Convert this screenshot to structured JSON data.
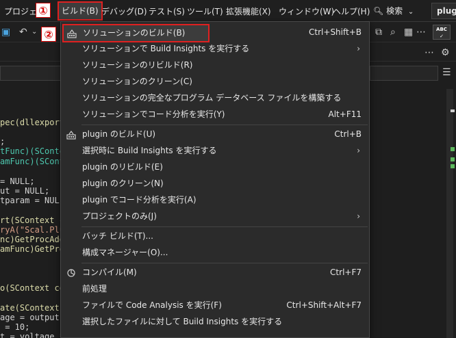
{
  "menubar": {
    "items": [
      "プロジェク",
      "ビルド(B)",
      "デバッグ(D)",
      "テスト(S)",
      "ツール(T)",
      "拡張機能(X)",
      "ウィンドウ(W)",
      "ヘルプ(H)"
    ],
    "search_label": "検索",
    "tab_label": "plugin"
  },
  "badges": {
    "one": "①",
    "two": "②"
  },
  "toolbar": {
    "spell_label": "ABC"
  },
  "build_menu": {
    "items": [
      {
        "label": "ソリューションのビルド(B)",
        "shortcut": "Ctrl+Shift+B",
        "icon": "build-icon",
        "submenu": false
      },
      {
        "label": "ソリューションで Build Insights を実行する",
        "shortcut": "",
        "icon": "",
        "submenu": true
      },
      {
        "label": "ソリューションのリビルド(R)",
        "shortcut": "",
        "icon": "",
        "submenu": false
      },
      {
        "label": "ソリューションのクリーン(C)",
        "shortcut": "",
        "icon": "",
        "submenu": false
      },
      {
        "label": "ソリューションの完全なプログラム データベース ファイルを構築する",
        "shortcut": "",
        "icon": "",
        "submenu": false
      },
      {
        "label": "ソリューションでコード分析を実行(Y)",
        "shortcut": "Alt+F11",
        "icon": "",
        "submenu": false
      },
      {
        "label": "plugin のビルド(U)",
        "shortcut": "Ctrl+B",
        "icon": "build-icon",
        "submenu": false
      },
      {
        "label": "選択時に Build Insights を実行する",
        "shortcut": "",
        "icon": "",
        "submenu": true
      },
      {
        "label": "plugin のリビルド(E)",
        "shortcut": "",
        "icon": "",
        "submenu": false
      },
      {
        "label": "plugin のクリーン(N)",
        "shortcut": "",
        "icon": "",
        "submenu": false
      },
      {
        "label": "plugin でコード分析を実行(A)",
        "shortcut": "",
        "icon": "",
        "submenu": false
      },
      {
        "label": "プロジェクトのみ(J)",
        "shortcut": "",
        "icon": "",
        "submenu": true
      },
      {
        "label": "バッチ ビルド(T)...",
        "shortcut": "",
        "icon": "",
        "submenu": false
      },
      {
        "label": "構成マネージャー(O)...",
        "shortcut": "",
        "icon": "",
        "submenu": false
      },
      {
        "label": "コンパイル(M)",
        "shortcut": "Ctrl+F7",
        "icon": "compile-icon",
        "submenu": false
      },
      {
        "label": "前処理",
        "shortcut": "",
        "icon": "",
        "submenu": false
      },
      {
        "label": "ファイルで Code Analysis を実行(F)",
        "shortcut": "Ctrl+Shift+Alt+F7",
        "icon": "",
        "submenu": false
      },
      {
        "label": "選択したファイルに対して Build Insights を実行する",
        "shortcut": "",
        "icon": "",
        "submenu": false
      }
    ]
  },
  "code": {
    "lines": [
      "pec(dllexport",
      ";",
      "tFunc)(SConte",
      "amFunc)(SConte",
      "= NULL;",
      "ut = NULL;",
      "tparam = NULL",
      "rt(SContext c",
      "ryA(\"Scal.Plu",
      "nc)GetProcAdd",
      "amFunc)GetPro",
      "o(SContext co",
      "ate(SContext",
      "age = output(c",
      " = 10;",
      "t = voltage * voltage / POWER;"
    ]
  },
  "colors": {
    "accent_red": "#e02020",
    "menu_bg": "#2b2b2b",
    "highlight_bg": "#3c3c3c"
  }
}
